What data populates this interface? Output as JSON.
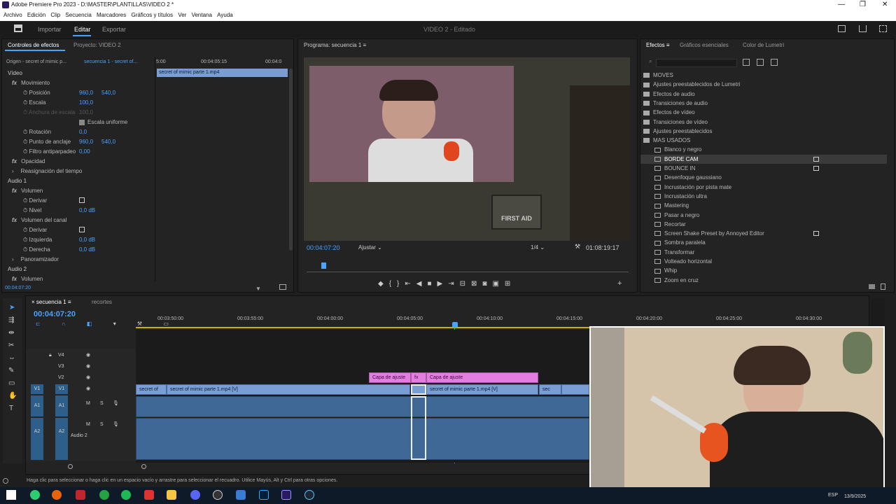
{
  "window": {
    "title": "Adobe Premiere Pro 2023 - D:\\MASTER\\PLANTILLAS\\VIDEO 2 *"
  },
  "menu": [
    "Archivo",
    "Edición",
    "Clip",
    "Secuencia",
    "Marcadores",
    "Gráficos y títulos",
    "Ver",
    "Ventana",
    "Ayuda"
  ],
  "workspace": {
    "tabs": [
      "Importar",
      "Editar",
      "Exportar"
    ],
    "project_title": "VIDEO 2 - Editado"
  },
  "effect_controls": {
    "tab1": "Controles de efectos",
    "tab2": "Proyecto: VIDEO 2",
    "source": "Origen - secret of mimic p...",
    "target": "secuencia 1 - secret of...",
    "ruler_start": "5:00",
    "ruler_mid": "00:04:05:15",
    "ruler_end": "00:04:0",
    "clip_label": "secret of mimic parte 1.mp4",
    "timecode": "00:04:07:20",
    "rows": [
      {
        "label": "Vídeo"
      },
      {
        "label": "Movimiento"
      },
      {
        "label": "Posición",
        "v1": "960,0",
        "v2": "540,0"
      },
      {
        "label": "Escala",
        "v1": "100,0"
      },
      {
        "label": "Anchura de escala",
        "v1": "100,0"
      },
      {
        "label": "Escala uniforme"
      },
      {
        "label": "Rotación",
        "v1": "0,0"
      },
      {
        "label": "Punto de anclaje",
        "v1": "960,0",
        "v2": "540,0"
      },
      {
        "label": "Filtro antiparpadeo",
        "v1": "0,00"
      },
      {
        "label": "Opacidad"
      },
      {
        "label": "Reasignación del tiempo"
      },
      {
        "label": "Audio 1"
      },
      {
        "label": "Volumen"
      },
      {
        "label": "Derivar"
      },
      {
        "label": "Nivel",
        "v1": "0,0 dB"
      },
      {
        "label": "Volumen del canal"
      },
      {
        "label": "Derivar"
      },
      {
        "label": "Izquierda",
        "v1": "0,0 dB"
      },
      {
        "label": "Derecha",
        "v1": "0,0 dB"
      },
      {
        "label": "Panoramizador"
      },
      {
        "label": "Audio 2"
      },
      {
        "label": "Volumen"
      }
    ]
  },
  "program": {
    "tab": "Programa: secuencia 1",
    "timecode": "00:04:07:20",
    "fit": "Ajustar",
    "quality": "1/4",
    "duration": "01:08:19:17"
  },
  "effects": {
    "tabs": [
      "Efectos",
      "Gráficos esenciales",
      "Color de Lumetri"
    ],
    "items": [
      {
        "label": "MOVES",
        "type": "folder"
      },
      {
        "label": "Ajustes preestablecidos de Lumetri",
        "type": "folder"
      },
      {
        "label": "Efectos de audio",
        "type": "folder"
      },
      {
        "label": "Transiciones de audio",
        "type": "folder"
      },
      {
        "label": "Efectos de vídeo",
        "type": "folder"
      },
      {
        "label": "Transiciones de vídeo",
        "type": "folder"
      },
      {
        "label": "Ajustes preestablecidos",
        "type": "folder"
      },
      {
        "label": "MAS USADOS",
        "type": "folder-open"
      },
      {
        "label": "Blanco y negro",
        "type": "fx"
      },
      {
        "label": "BORDE CAM",
        "type": "fx",
        "selected": true,
        "badge": true
      },
      {
        "label": "BOUNCE IN",
        "type": "fx",
        "badge": true
      },
      {
        "label": "Desenfoque gaussiano",
        "type": "fx"
      },
      {
        "label": "Incrustación por pista mate",
        "type": "fx"
      },
      {
        "label": "Incrustación ultra",
        "type": "fx"
      },
      {
        "label": "Mastering",
        "type": "fx"
      },
      {
        "label": "Pasar a negro",
        "type": "fx"
      },
      {
        "label": "Recortar",
        "type": "fx"
      },
      {
        "label": "Screen Shake Preset by Annoyed Editor",
        "type": "fx",
        "badge": true
      },
      {
        "label": "Sombra paralela",
        "type": "fx"
      },
      {
        "label": "Transformar",
        "type": "fx"
      },
      {
        "label": "Volteado horizontal",
        "type": "fx"
      },
      {
        "label": "Whip",
        "type": "fx"
      },
      {
        "label": "Zoom en cruz",
        "type": "fx"
      }
    ]
  },
  "timeline": {
    "tab": "secuencia 1",
    "tab2": "recortes",
    "timecode": "00:04:07:20",
    "ruler": [
      "00:03:50:00",
      "00:03:55:00",
      "00:04:00:00",
      "00:04:05:00",
      "00:04:10:00",
      "00:04:15:00",
      "00:04:20:00",
      "00:04:25:00",
      "00:04:30:00"
    ],
    "tracks": [
      "V4",
      "V3",
      "V2",
      "V1",
      "A1",
      "A2"
    ],
    "v2_clips": [
      "Capa de ajuste",
      "fx",
      "Capa de ajuste"
    ],
    "v1_clips": [
      "secret of",
      "secret of mimic parte 1.mp4 [V]",
      "secret of mimic parte 1.mp4 [V]",
      "sec"
    ],
    "audio2_label": "Audio 2"
  },
  "status": "Haga clic para seleccionar o haga clic en un espacio vacío y arrastre para seleccionar el recuadro. Utilice Mayús, Alt y Ctrl para otras opciones.",
  "tray": {
    "lang": "ESP",
    "date": "13/9/2025"
  },
  "colors": {
    "accent": "#4aa3ff",
    "adjust": "#e37ee0",
    "video_clip": "#7a9ed4",
    "audio_clip": "#3f6896"
  }
}
